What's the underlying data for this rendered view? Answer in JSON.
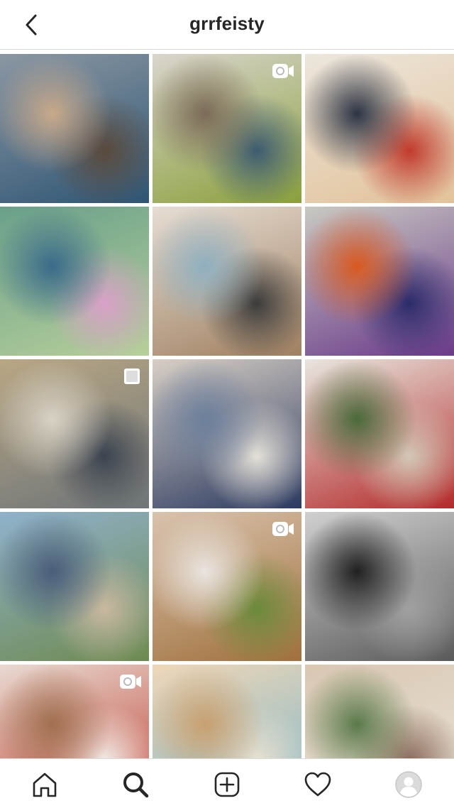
{
  "header": {
    "back_icon": "chevron-left-icon",
    "username": "grrfeisty"
  },
  "grid": {
    "posts": [
      {
        "name": "post-two-toddlers-plaid",
        "colors": [
          "#8b97a3",
          "#2e5573",
          "#c8a98a",
          "#5a4a3c"
        ],
        "badge": null
      },
      {
        "name": "post-living-room",
        "colors": [
          "#d9d5cd",
          "#8aa03a",
          "#7b6a58",
          "#3d5b70"
        ],
        "badge": "video"
      },
      {
        "name": "post-girl-craft-table",
        "colors": [
          "#ece6dc",
          "#e2c29a",
          "#2c3444",
          "#c0392b"
        ],
        "badge": null
      },
      {
        "name": "post-child-pool-goggles",
        "colors": [
          "#69a08a",
          "#b7cf9a",
          "#3a6a8a",
          "#d9a0c8"
        ],
        "badge": null
      },
      {
        "name": "post-twins-heart-shirts",
        "colors": [
          "#e6ddd3",
          "#a08060",
          "#8fb0c0",
          "#3c3c3c"
        ],
        "badge": null
      },
      {
        "name": "post-snow-kids",
        "colors": [
          "#c9c9c2",
          "#6b3a8a",
          "#d85a20",
          "#2c2c6a"
        ],
        "badge": null
      },
      {
        "name": "post-twins-striped-window",
        "colors": [
          "#b9a784",
          "#6e7478",
          "#d8d2c5",
          "#3c4450"
        ],
        "badge": "multiple"
      },
      {
        "name": "post-vaccine-cards",
        "colors": [
          "#d8cfc5",
          "#2b3a60",
          "#6c7f9c",
          "#e4e0d8"
        ],
        "badge": null
      },
      {
        "name": "post-girl-red-backpack",
        "colors": [
          "#e8e6df",
          "#b32a2a",
          "#4a6a3a",
          "#d2c7b5"
        ],
        "badge": null
      },
      {
        "name": "post-family-fountain",
        "colors": [
          "#8fb2cc",
          "#6e8a50",
          "#4a5d7a",
          "#c9b8a0"
        ],
        "badge": null
      },
      {
        "name": "post-laughing-toddlers",
        "colors": [
          "#d9c3ad",
          "#a0703c",
          "#e9e4df",
          "#6a8a3a"
        ],
        "badge": "video"
      },
      {
        "name": "post-hospital-bw",
        "colors": [
          "#d0d0d0",
          "#5a5a5a",
          "#202020",
          "#a0a0a0"
        ],
        "badge": null
      },
      {
        "name": "post-toddler-feeding-tube",
        "colors": [
          "#e8dad2",
          "#c04030",
          "#a07050",
          "#f2ece8"
        ],
        "badge": "video"
      },
      {
        "name": "post-sleeping-child-hospital",
        "colors": [
          "#efd7b8",
          "#7fb6c8",
          "#c8a070",
          "#e9e0d0"
        ],
        "badge": null
      },
      {
        "name": "post-girl-sweater",
        "colors": [
          "#d9c7b2",
          "#eae4da",
          "#5a7a4a",
          "#8a6a5a"
        ],
        "badge": null
      }
    ]
  },
  "tabbar": {
    "items": [
      {
        "name": "home",
        "icon": "home-icon"
      },
      {
        "name": "search",
        "icon": "search-icon"
      },
      {
        "name": "new-post",
        "icon": "add-post-icon"
      },
      {
        "name": "activity",
        "icon": "heart-icon"
      },
      {
        "name": "profile",
        "icon": "profile-avatar-icon"
      }
    ]
  },
  "colors": {
    "text": "#262626",
    "divider": "#dbdbdb",
    "background": "#ffffff"
  }
}
